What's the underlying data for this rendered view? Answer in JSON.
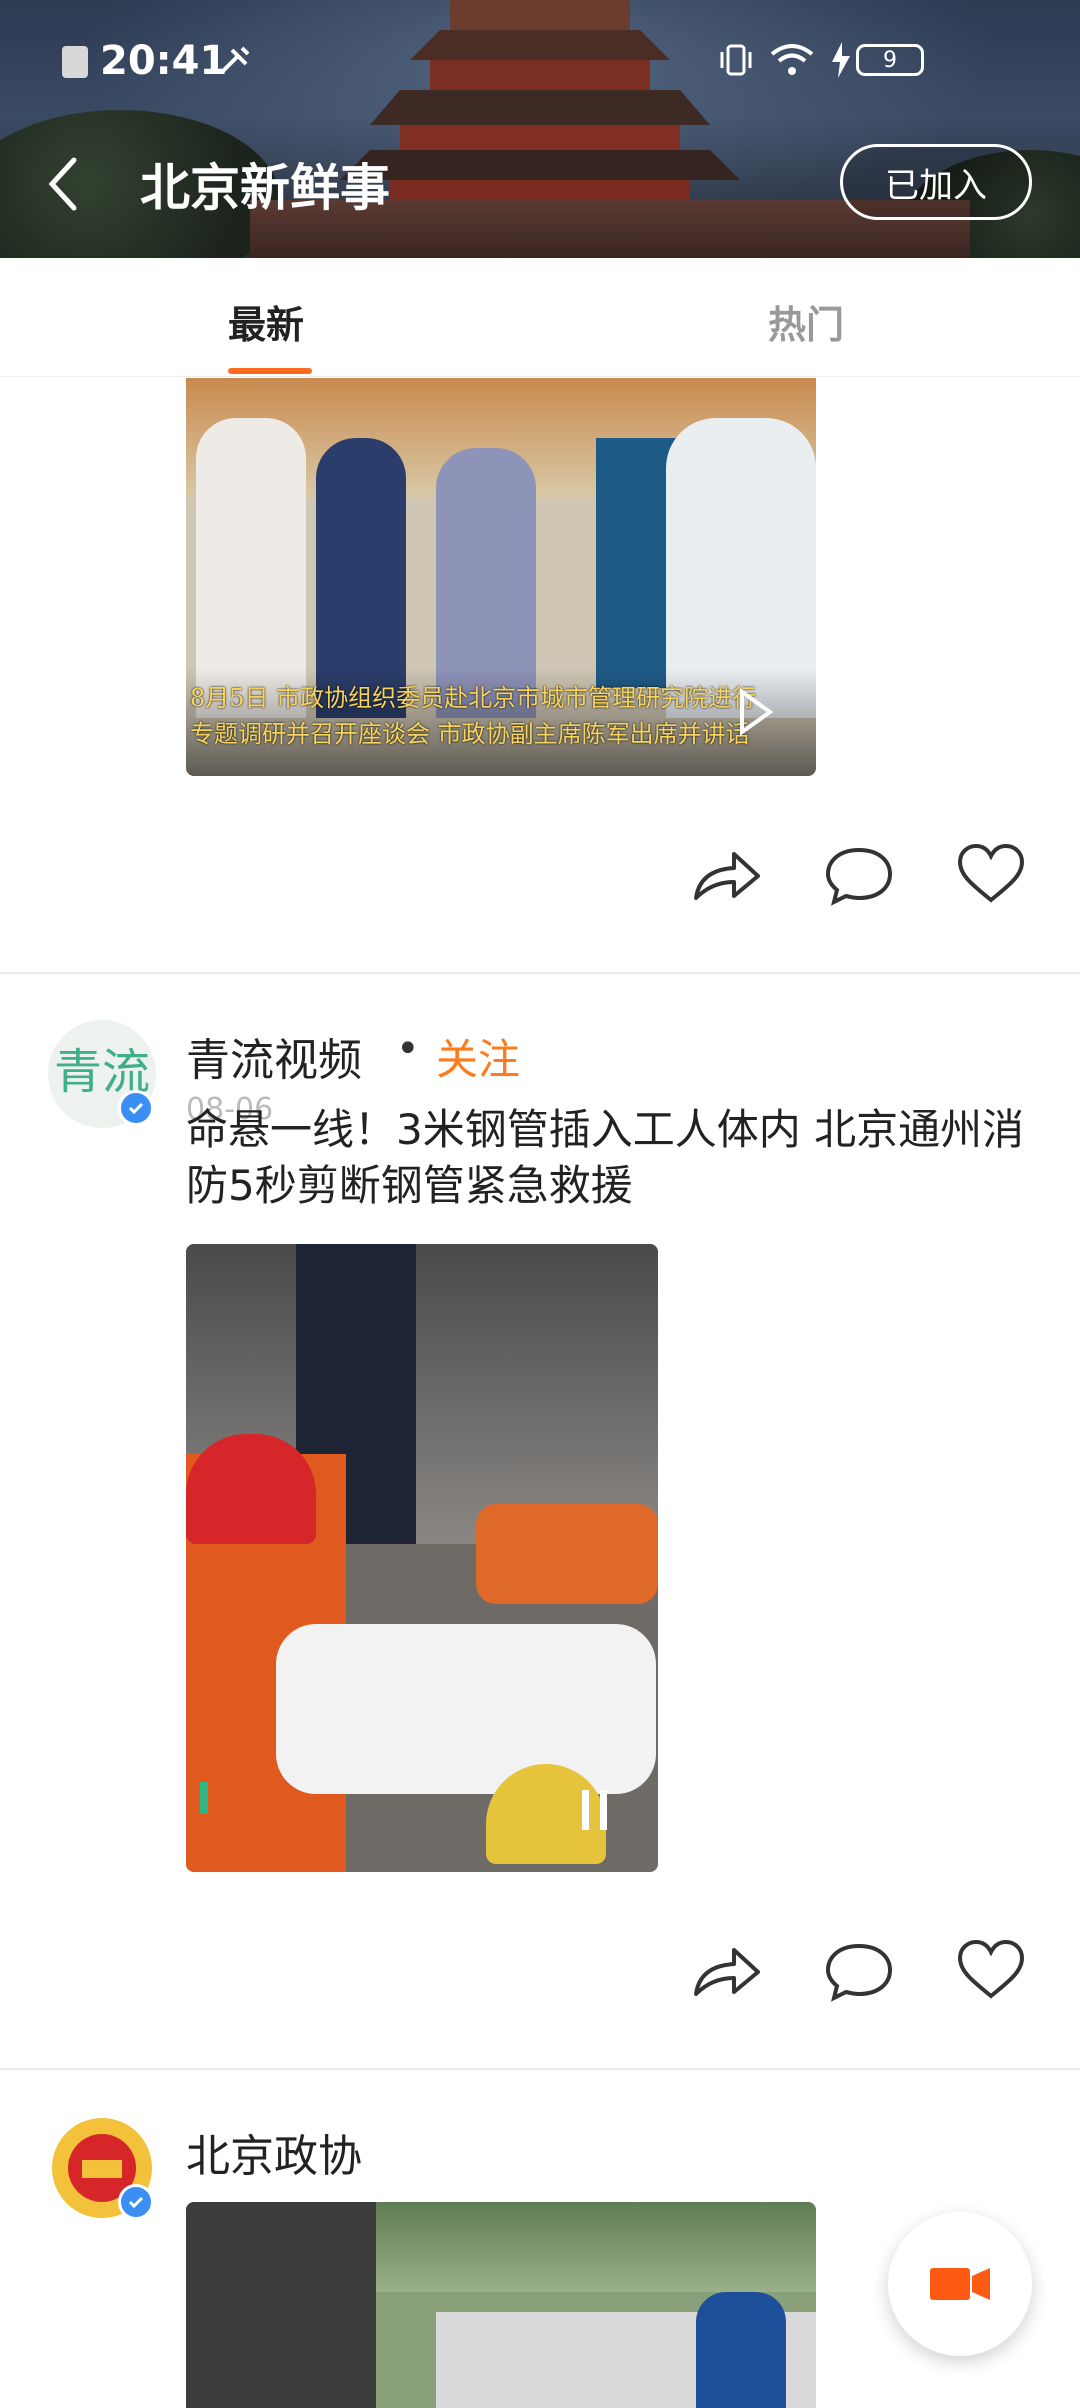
{
  "status_bar": {
    "time": "20:41",
    "battery": "9"
  },
  "header": {
    "title": "北京新鲜事",
    "join_button": "已加入"
  },
  "tabs": {
    "active": "最新",
    "inactive": "热门"
  },
  "posts": [
    {
      "video_caption_line1": "8月5日 市政协组织委员赴北京市城市管理研究院进行",
      "video_caption_line2": "专题调研并召开座谈会 市政协副主席陈军出席并讲话"
    },
    {
      "author": "青流视频",
      "follow": "关注",
      "date": "08-06",
      "text": "命悬一线！3米钢管插入工人体内 北京通州消防5秒剪断钢管紧急救援"
    },
    {
      "author": "北京政协"
    }
  ],
  "icons": [
    "back-icon",
    "share-icon",
    "comment-icon",
    "like-icon",
    "play-icon",
    "pause-icon",
    "camera-icon"
  ]
}
